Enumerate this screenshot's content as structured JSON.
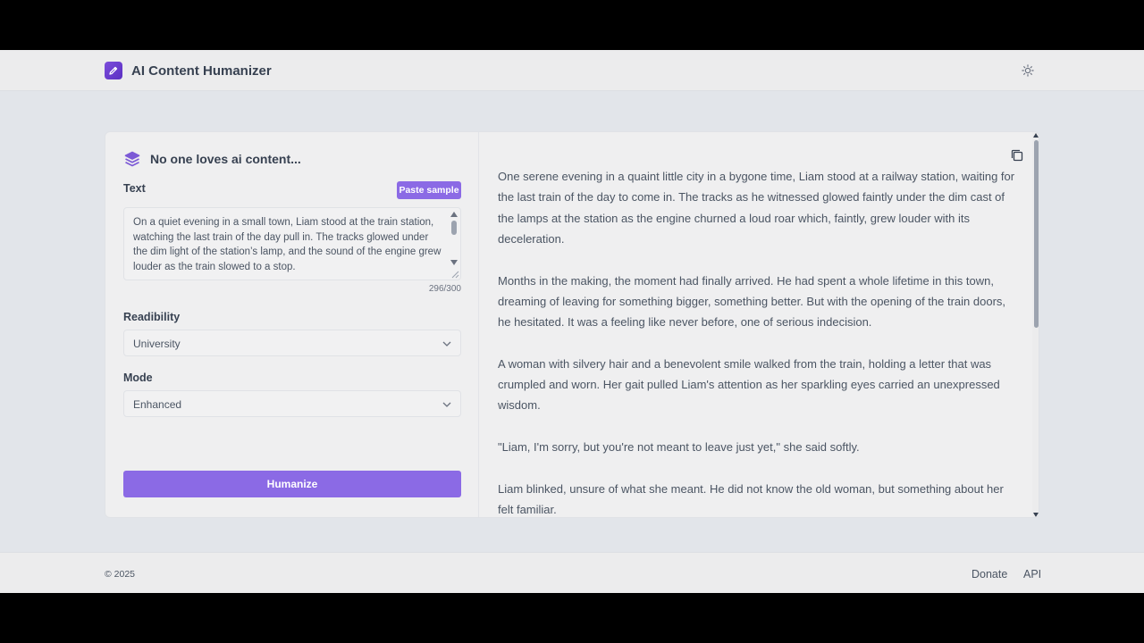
{
  "header": {
    "title": "AI Content Humanizer",
    "logo_icon": "pencil-icon",
    "theme_icon": "sun-icon"
  },
  "panel": {
    "title": "No one loves ai content...",
    "text_label": "Text",
    "paste_button": "Paste sample",
    "input_text": "On a quiet evening in a small town, Liam stood at the train station, watching the last train of the day pull in. The tracks glowed under the dim light of the station’s lamp, and the sound of the engine grew louder as the train slowed to a stop.",
    "char_count": "296/300",
    "readability_label": "Readibility",
    "readability_value": "University",
    "mode_label": "Mode",
    "mode_value": "Enhanced",
    "humanize_button": "Humanize"
  },
  "output": {
    "paragraphs": [
      "One serene evening in a quaint little city in a bygone time, Liam stood at a railway station, waiting for the last train of the day to come in. The tracks as he witnessed glowed faintly under the dim cast of the lamps at the station as the engine churned a loud roar which, faintly, grew louder with its deceleration.",
      "Months in the making, the moment had finally arrived. He had spent a whole lifetime in this town, dreaming of leaving for something bigger, something better. But with the opening of the train doors, he hesitated. It was a feeling like never before, one of serious indecision.",
      "A woman with silvery hair and a benevolent smile walked from the train, holding a letter that was crumpled and worn. Her gait pulled Liam's attention as her sparkling eyes carried an unexpressed wisdom.",
      "\"Liam, I'm sorry, but you're not meant to leave just yet,\" she said softly.",
      "Liam blinked, unsure of what she meant. He did not know the old woman, but something about her felt familiar."
    ]
  },
  "footer": {
    "copyright": "© 2025",
    "donate": "Donate",
    "api": "API"
  },
  "colors": {
    "accent": "#8b6ae5",
    "logo": "#6a3bd4",
    "background": "#e2e5ea",
    "card": "#efeff0"
  }
}
